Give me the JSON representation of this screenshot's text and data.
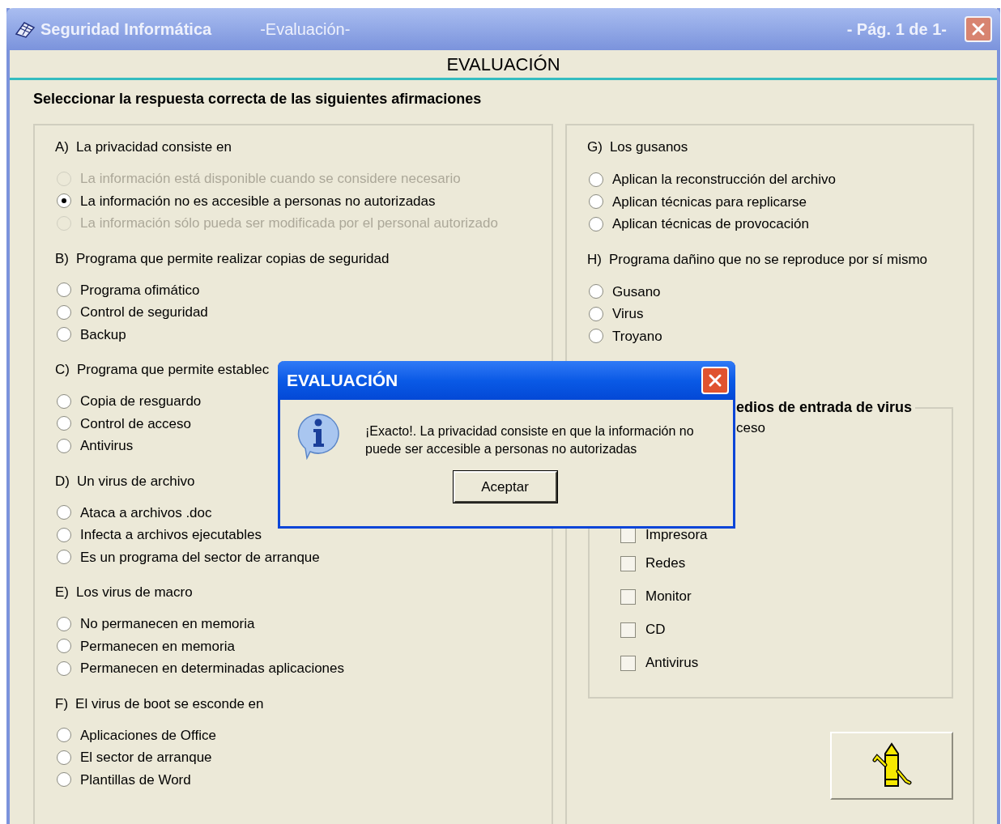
{
  "window": {
    "title": "Seguridad Informática",
    "subtitle": "-Evaluación-",
    "page": "- Pág. 1 de 1-"
  },
  "heading": "EVALUACIÓN",
  "instruction": "Seleccionar la respuesta correcta de las siguientes afirmaciones",
  "left_questions": [
    {
      "letter": "A)",
      "text": "La privacidad consiste en",
      "options": [
        {
          "label": "La información está disponible cuando se considere necesario",
          "selected": false,
          "disabled": true
        },
        {
          "label": "La información no es accesible a personas no autorizadas",
          "selected": true,
          "disabled": false
        },
        {
          "label": "La información sólo pueda ser modificada por el personal autorizado",
          "selected": false,
          "disabled": true
        }
      ]
    },
    {
      "letter": "B)",
      "text": "Programa que permite realizar copias de seguridad",
      "options": [
        {
          "label": "Programa ofimático",
          "selected": false,
          "disabled": false
        },
        {
          "label": "Control de seguridad",
          "selected": false,
          "disabled": false
        },
        {
          "label": "Backup",
          "selected": false,
          "disabled": false
        }
      ]
    },
    {
      "letter": "C)",
      "text": "Programa que permite establec",
      "options": [
        {
          "label": "Copia de resguardo",
          "selected": false,
          "disabled": false
        },
        {
          "label": "Control de acceso",
          "selected": false,
          "disabled": false
        },
        {
          "label": "Antivirus",
          "selected": false,
          "disabled": false
        }
      ]
    },
    {
      "letter": "D)",
      "text": "Un virus de archivo",
      "options": [
        {
          "label": "Ataca a archivos .doc",
          "selected": false,
          "disabled": false
        },
        {
          "label": "Infecta a archivos ejecutables",
          "selected": false,
          "disabled": false
        },
        {
          "label": "Es un programa del sector de arranque",
          "selected": false,
          "disabled": false
        }
      ]
    },
    {
      "letter": "E)",
      "text": "Los virus de macro",
      "options": [
        {
          "label": "No permanecen en memoria",
          "selected": false,
          "disabled": false
        },
        {
          "label": "Permanecen en memoria",
          "selected": false,
          "disabled": false
        },
        {
          "label": "Permanecen en determinadas aplicaciones",
          "selected": false,
          "disabled": false
        }
      ]
    },
    {
      "letter": "F)",
      "text": "El virus de boot se esconde en",
      "options": [
        {
          "label": "Aplicaciones de Office",
          "selected": false,
          "disabled": false
        },
        {
          "label": "El sector de arranque",
          "selected": false,
          "disabled": false
        },
        {
          "label": "Plantillas de Word",
          "selected": false,
          "disabled": false
        }
      ]
    }
  ],
  "right_questions": [
    {
      "letter": "G)",
      "text": "Los gusanos",
      "options": [
        {
          "label": "Aplican la reconstrucción del archivo",
          "selected": false,
          "disabled": false
        },
        {
          "label": "Aplican técnicas para replicarse",
          "selected": false,
          "disabled": false
        },
        {
          "label": "Aplican técnicas de provocación",
          "selected": false,
          "disabled": false
        }
      ]
    },
    {
      "letter": "H)",
      "text": "Programa dañino que no se reproduce por sí mismo",
      "options": [
        {
          "label": "Gusano",
          "selected": false,
          "disabled": false
        },
        {
          "label": "Virus",
          "selected": false,
          "disabled": false
        },
        {
          "label": "Troyano",
          "selected": false,
          "disabled": false
        }
      ]
    }
  ],
  "virus_group": {
    "legend": "edios de entrada de virus",
    "items": [
      {
        "kind": "clipped",
        "label": "ceso"
      },
      {
        "kind": "checkbox",
        "label": "Impresora",
        "checked": false
      },
      {
        "kind": "checkbox",
        "label": "Redes",
        "checked": false
      },
      {
        "kind": "checkbox",
        "label": "Monitor",
        "checked": false
      },
      {
        "kind": "checkbox",
        "label": "CD",
        "checked": false
      },
      {
        "kind": "checkbox",
        "label": "Antivirus",
        "checked": false
      }
    ]
  },
  "dialog": {
    "title": "EVALUACIÓN",
    "message": "¡Exacto!. La privacidad consiste en que la información no puede ser accesible a personas no autorizadas",
    "button": "Aceptar"
  }
}
